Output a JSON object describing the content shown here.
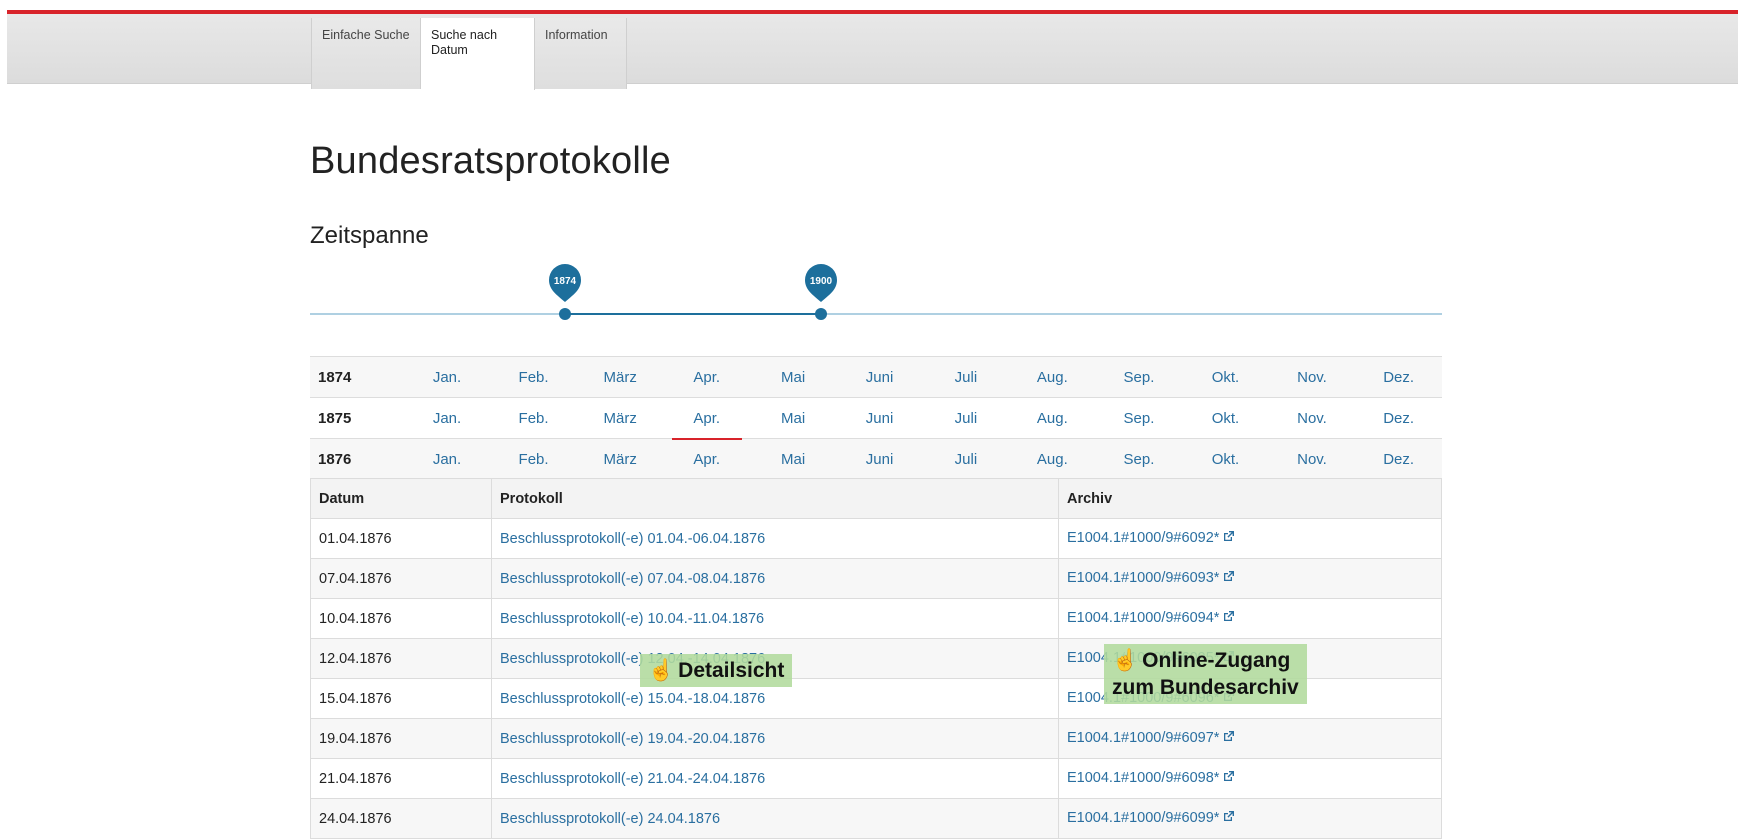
{
  "nav": {
    "tabs": [
      {
        "label": "Einfache Suche",
        "active": false
      },
      {
        "label": "Suche nach Datum",
        "active": true
      },
      {
        "label": "Information",
        "active": false
      }
    ]
  },
  "page": {
    "title": "Bundesratsprotokolle",
    "section_title": "Zeitspanne"
  },
  "range_slider": {
    "start_label": "1874",
    "end_label": "1900",
    "start_value": 1874,
    "end_value": 1900,
    "min": 1848,
    "max": 2000
  },
  "month_grid": [
    {
      "year": "1874",
      "months": [
        "Jan.",
        "Feb.",
        "März",
        "Apr.",
        "Mai",
        "Juni",
        "Juli",
        "Aug.",
        "Sep.",
        "Okt.",
        "Nov.",
        "Dez."
      ]
    },
    {
      "year": "1875",
      "months": [
        "Jan.",
        "Feb.",
        "März",
        "Apr.",
        "Mai",
        "Juni",
        "Juli",
        "Aug.",
        "Sep.",
        "Okt.",
        "Nov.",
        "Dez."
      ]
    },
    {
      "year": "1876",
      "months": [
        "Jan.",
        "Feb.",
        "März",
        "Apr.",
        "Mai",
        "Juni",
        "Juli",
        "Aug.",
        "Sep.",
        "Okt.",
        "Nov.",
        "Dez."
      ]
    }
  ],
  "selected_month": {
    "year": "1876",
    "month": "Apr."
  },
  "results_table": {
    "headers": [
      "Datum",
      "Protokoll",
      "Archiv"
    ],
    "rows": [
      {
        "date": "01.04.1876",
        "protocol": "Beschlussprotokoll(-e) 01.04.-06.04.1876",
        "archive": "E1004.1#1000/9#6092*"
      },
      {
        "date": "07.04.1876",
        "protocol": "Beschlussprotokoll(-e) 07.04.-08.04.1876",
        "archive": "E1004.1#1000/9#6093*"
      },
      {
        "date": "10.04.1876",
        "protocol": "Beschlussprotokoll(-e) 10.04.-11.04.1876",
        "archive": "E1004.1#1000/9#6094*"
      },
      {
        "date": "12.04.1876",
        "protocol": "Beschlussprotokoll(-e) 12.04.-14.04.1876",
        "archive": "E1004.1#1000/9#6095*"
      },
      {
        "date": "15.04.1876",
        "protocol": "Beschlussprotokoll(-e) 15.04.-18.04.1876",
        "archive": "E1004.1#1000/9#6096*"
      },
      {
        "date": "19.04.1876",
        "protocol": "Beschlussprotokoll(-e) 19.04.-20.04.1876",
        "archive": "E1004.1#1000/9#6097*"
      },
      {
        "date": "21.04.1876",
        "protocol": "Beschlussprotokoll(-e) 21.04.-24.04.1876",
        "archive": "E1004.1#1000/9#6098*"
      },
      {
        "date": "24.04.1876",
        "protocol": "Beschlussprotokoll(-e) 24.04.1876",
        "archive": "E1004.1#1000/9#6099*"
      }
    ]
  },
  "callouts": {
    "detail": "Detailsicht",
    "online_line1": "Online-Zugang",
    "online_line2": "zum Bundesarchiv"
  },
  "icons": {
    "external_link": "external-link-icon",
    "hand_pointer": "hand-pointer-icon"
  },
  "colors": {
    "accent_red": "#d8232a",
    "link_blue": "#2a6fa0",
    "slider_blue": "#1d6f9c",
    "callout_green": "#b2db9d"
  }
}
